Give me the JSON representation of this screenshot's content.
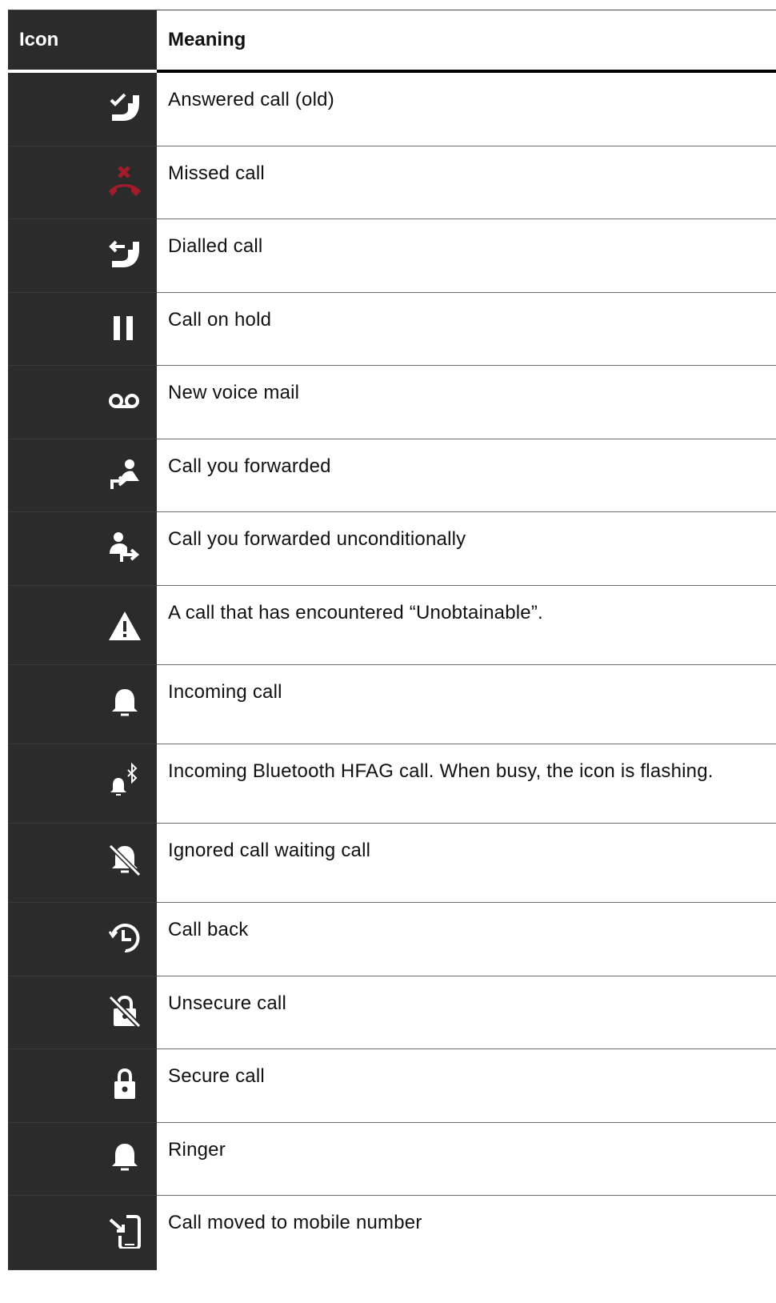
{
  "table": {
    "headers": {
      "icon": "Icon",
      "meaning": "Meaning"
    },
    "rows": [
      {
        "icon": "answered-call-icon",
        "meaning": "Answered call (old)"
      },
      {
        "icon": "missed-call-icon",
        "meaning": "Missed call",
        "icon_color": "#a01c2a"
      },
      {
        "icon": "dialled-call-icon",
        "meaning": "Dialled call"
      },
      {
        "icon": "pause-icon",
        "meaning": "Call on hold"
      },
      {
        "icon": "voicemail-icon",
        "meaning": "New voice mail"
      },
      {
        "icon": "call-forwarded-icon",
        "meaning": "Call you forwarded"
      },
      {
        "icon": "call-forwarded-unconditionally-icon",
        "meaning": "Call you forwarded unconditionally"
      },
      {
        "icon": "warning-icon",
        "meaning": "A call that has encountered “Unobtainable”."
      },
      {
        "icon": "bell-icon",
        "meaning": "Incoming call"
      },
      {
        "icon": "bluetooth-bell-icon",
        "meaning": "Incoming Bluetooth HFAG call. When busy, the icon is flashing."
      },
      {
        "icon": "bell-off-icon",
        "meaning": "Ignored call waiting call"
      },
      {
        "icon": "call-back-icon",
        "meaning": "Call back"
      },
      {
        "icon": "unlocked-crossed-icon",
        "meaning": "Unsecure call"
      },
      {
        "icon": "lock-icon",
        "meaning": "Secure call"
      },
      {
        "icon": "bell-icon",
        "meaning": "Ringer"
      },
      {
        "icon": "moved-to-mobile-icon",
        "meaning": "Call moved to mobile number"
      }
    ]
  }
}
